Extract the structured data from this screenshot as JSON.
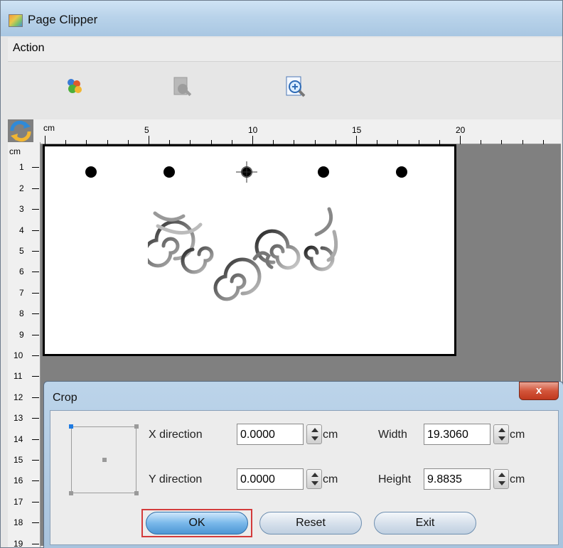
{
  "window": {
    "title": "Page Clipper"
  },
  "menu": {
    "items": [
      {
        "label": "Action"
      }
    ]
  },
  "toolbar": {
    "buttons": [
      {
        "name": "people-icon"
      },
      {
        "name": "zoom-out-disabled-icon"
      },
      {
        "name": "zoom-in-icon"
      }
    ]
  },
  "ruler": {
    "unit": "cm",
    "horizontal_labels": [
      "5",
      "10",
      "15",
      "20"
    ],
    "vertical_labels": [
      "1",
      "2",
      "3",
      "4",
      "5",
      "6",
      "7",
      "8",
      "9",
      "10",
      "11",
      "12",
      "13",
      "14",
      "15",
      "16",
      "17",
      "18",
      "19"
    ]
  },
  "dialog": {
    "title": "Crop",
    "close_label": "x",
    "x_direction": {
      "label": "X direction",
      "value": "0.0000",
      "unit": "cm"
    },
    "y_direction": {
      "label": "Y direction",
      "value": "0.0000",
      "unit": "cm"
    },
    "width": {
      "label": "Width",
      "value": "19.3060",
      "unit": "cm"
    },
    "height": {
      "label": "Height",
      "value": "9.8835",
      "unit": "cm"
    },
    "buttons": {
      "ok": "OK",
      "reset": "Reset",
      "exit": "Exit"
    }
  }
}
